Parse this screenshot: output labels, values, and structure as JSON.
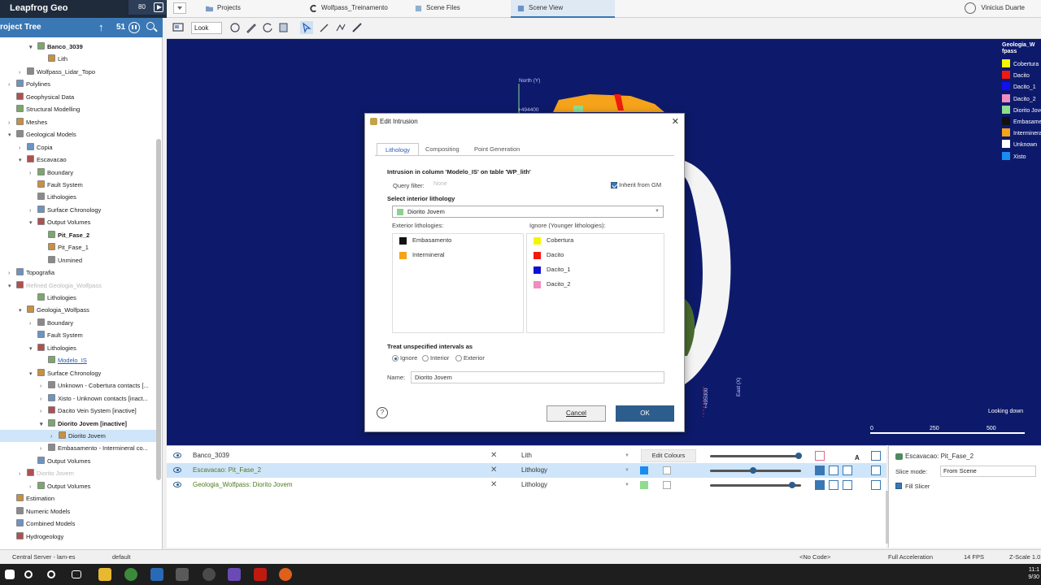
{
  "app": {
    "title": "Leapfrog Geo",
    "header_counter": "80"
  },
  "tabs": [
    {
      "label": "Projects",
      "icon": "folder-icon"
    },
    {
      "label": "Wolfpass_Treinamento",
      "icon": "leapfrog-icon"
    },
    {
      "label": "Scene Files",
      "icon": "scene-files-icon"
    },
    {
      "label": "Scene View",
      "icon": "scene-view-icon",
      "active": true
    }
  ],
  "user": {
    "name": "Vinicius Duarte"
  },
  "project_tree": {
    "title": "roject Tree",
    "count": "51",
    "items": [
      {
        "label": "Banco_3039",
        "indent": 2,
        "arrow": "▾",
        "bold": true
      },
      {
        "label": "Lith",
        "indent": 3,
        "arrow": ""
      },
      {
        "label": "Wolfpass_Lidar_Topo",
        "indent": 1,
        "arrow": "›"
      },
      {
        "label": "Polylines",
        "indent": 0,
        "arrow": "›"
      },
      {
        "label": "Geophysical Data",
        "indent": 0,
        "arrow": ""
      },
      {
        "label": "Structural Modelling",
        "indent": 0,
        "arrow": ""
      },
      {
        "label": "Meshes",
        "indent": 0,
        "arrow": "›"
      },
      {
        "label": "Geological Models",
        "indent": 0,
        "arrow": "▾"
      },
      {
        "label": "Copia",
        "indent": 1,
        "arrow": "›"
      },
      {
        "label": "Escavacao",
        "indent": 1,
        "arrow": "▾"
      },
      {
        "label": "Boundary",
        "indent": 2,
        "arrow": "›"
      },
      {
        "label": "Fault System",
        "indent": 2,
        "arrow": ""
      },
      {
        "label": "Lithologies",
        "indent": 2,
        "arrow": ""
      },
      {
        "label": "Surface Chronology",
        "indent": 2,
        "arrow": "›"
      },
      {
        "label": "Output Volumes",
        "indent": 2,
        "arrow": "▾"
      },
      {
        "label": "Pit_Fase_2",
        "indent": 3,
        "arrow": "",
        "bold": true
      },
      {
        "label": "Pit_Fase_1",
        "indent": 3,
        "arrow": ""
      },
      {
        "label": "Unmined",
        "indent": 3,
        "arrow": ""
      },
      {
        "label": "Topografia",
        "indent": 0,
        "arrow": "›"
      },
      {
        "label": "Refined Geologia_Wolfpass",
        "indent": 0,
        "arrow": "▾",
        "faded": true
      },
      {
        "label": "Lithologies",
        "indent": 2,
        "arrow": ""
      },
      {
        "label": "Geologia_Wolfpass",
        "indent": 1,
        "arrow": "▾"
      },
      {
        "label": "Boundary",
        "indent": 2,
        "arrow": "›"
      },
      {
        "label": "Fault System",
        "indent": 2,
        "arrow": ""
      },
      {
        "label": "Lithologies",
        "indent": 2,
        "arrow": "▾"
      },
      {
        "label": "Modelo_IS",
        "indent": 3,
        "arrow": "",
        "link": true
      },
      {
        "label": "Surface Chronology",
        "indent": 2,
        "arrow": "▾"
      },
      {
        "label": "Unknown - Cobertura contacts [...",
        "indent": 3,
        "arrow": "›"
      },
      {
        "label": "Xisto - Unknown contacts [inact...",
        "indent": 3,
        "arrow": "›"
      },
      {
        "label": "Dacito Vein System [inactive]",
        "indent": 3,
        "arrow": "›"
      },
      {
        "label": "Diorito Jovem [inactive]",
        "indent": 3,
        "arrow": "▾",
        "bold": true
      },
      {
        "label": "Diorito Jovem",
        "indent": 4,
        "arrow": "›",
        "selected": true
      },
      {
        "label": "Embasamento - Intermineral co...",
        "indent": 3,
        "arrow": "›"
      },
      {
        "label": "Output Volumes",
        "indent": 2,
        "arrow": ""
      },
      {
        "label": "Diorito Jovem",
        "indent": 1,
        "arrow": "›",
        "faded": true
      },
      {
        "label": "Output Volumes",
        "indent": 2,
        "arrow": "›"
      },
      {
        "label": "Estimation",
        "indent": 0,
        "arrow": ""
      },
      {
        "label": "Numeric Models",
        "indent": 0,
        "arrow": ""
      },
      {
        "label": "Combined Models",
        "indent": 0,
        "arrow": ""
      },
      {
        "label": "Hydrogeology",
        "indent": 0,
        "arrow": ""
      }
    ]
  },
  "view_toolbar": {
    "look_label": "Look"
  },
  "viewport": {
    "legend_title": "Geologia_W fpass",
    "legend": [
      {
        "label": "Cobertura",
        "color": "#f5f500"
      },
      {
        "label": "Dacito",
        "color": "#f01a10"
      },
      {
        "label": "Dacito_1",
        "color": "#1010f0"
      },
      {
        "label": "Dacito_2",
        "color": "#f08cc0"
      },
      {
        "label": "Diorito Jovem",
        "color": "#8fdc8f"
      },
      {
        "label": "Embasamento",
        "color": "#111111"
      },
      {
        "label": "Intermineral",
        "color": "#f5a31a"
      },
      {
        "label": "Unknown",
        "color": "#ffffff"
      },
      {
        "label": "Xisto",
        "color": "#1a8cf0"
      }
    ],
    "axis_north": "North (Y)",
    "axis_north_value": "+494400",
    "axis_east": "East (X)",
    "axis_east_value": "+495000",
    "looking": "Looking down",
    "scale_labels": [
      "0",
      "250",
      "500"
    ]
  },
  "shown_objects": [
    {
      "name": "Banco_3039",
      "column": "Lith",
      "selected": false,
      "green": false,
      "swatch": null,
      "knob": 0.97
    },
    {
      "name": "Escavacao: Pit_Fase_2",
      "column": "Lithology",
      "selected": true,
      "green": true,
      "swatch": "#1a8cf0",
      "knob": 0.45
    },
    {
      "name": "Geologia_Wolfpass: Diorito Jovem",
      "column": "Lithology",
      "selected": false,
      "green": true,
      "swatch": "#8fdc8f",
      "knob": 0.9
    }
  ],
  "edit_colours_label": "Edit Colours",
  "properties": {
    "title": "Escavacao: Pit_Fase_2",
    "slice_mode_label": "Slice mode:",
    "slice_mode_value": "From Scene",
    "fill_slicer_label": "Fill Slicer"
  },
  "dialog": {
    "title": "Edit Intrusion",
    "tabs": [
      "Lithology",
      "Compositing",
      "Point Generation"
    ],
    "intro": "Intrusion in column 'Modelo_IS' on table 'WP_lith'",
    "query_filter_label": "Query filter:",
    "query_filter_value": "None",
    "inherit_label": "Inherit from GM",
    "select_interior_label": "Select interior lithology",
    "interior_value": "Diorito Jovem",
    "interior_color": "#8fcf8f",
    "exterior_label": "Exterior lithologies:",
    "ignore_label": "Ignore (Younger lithologies):",
    "exterior": [
      {
        "label": "Embasamento",
        "color": "#111111"
      },
      {
        "label": "Intermineral",
        "color": "#f5a31a"
      }
    ],
    "ignore": [
      {
        "label": "Cobertura",
        "color": "#f5f500"
      },
      {
        "label": "Dacito",
        "color": "#f01a10"
      },
      {
        "label": "Dacito_1",
        "color": "#1010d0"
      },
      {
        "label": "Dacito_2",
        "color": "#f08cc0"
      }
    ],
    "treat_label": "Treat unspecified intervals as",
    "radio": [
      "Ignore",
      "Interior",
      "Exterior"
    ],
    "name_label": "Name:",
    "name_value": "Diorito Jovem",
    "help": "?",
    "cancel": "Cancel",
    "ok": "OK"
  },
  "status_bar": {
    "server": "Central Server - lam-es",
    "branch": "default",
    "code": "<No Code>",
    "accel": "Full Acceleration",
    "fps": "14 FPS",
    "zscale": "Z-Scale 1.0"
  },
  "taskbar": {
    "time": "11:1",
    "date": "9/30"
  }
}
